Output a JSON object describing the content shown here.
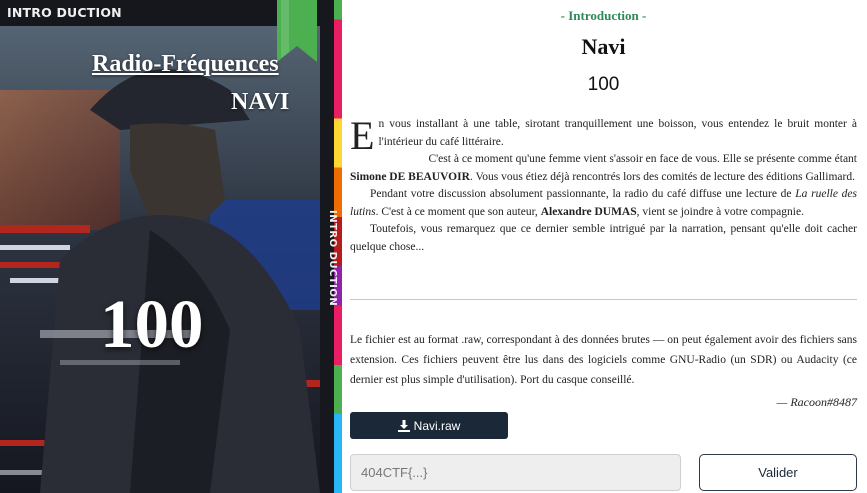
{
  "card": {
    "category_label": "INTRO DUCTION",
    "title": "Radio-Fréquences",
    "subtitle": "NAVI",
    "number": "100",
    "spine_label": "INTRO DUCTION",
    "bookmark_color": "#4caf50"
  },
  "challenge": {
    "section": "- Introduction -",
    "title": "Navi",
    "points": "100"
  },
  "story": {
    "p1_dropcap": "E",
    "p1_text": "n vous installant à une table, sirotant tranquillement une boisson, vous entendez le bruit monter à l'intérieur du café littéraire.",
    "p2_a": "C'est à ce moment qu'une femme vient s'assoir en face de vous. Elle se présente comme étant ",
    "p2_name": "Simone DE BEAUVOIR",
    "p2_b": ". Vous vous étiez déjà rencontrés lors des comités de lecture des éditions Gallimard.",
    "p3_a": "Pendant votre discussion absolument passionnante, la radio du café diffuse une lecture de ",
    "p3_book": "La ruelle des lutins",
    "p3_b": ". C'est à ce moment que son auteur, ",
    "p3_name": "Alexandre DUMAS",
    "p3_c": ", vient se joindre à votre compagnie.",
    "p4": "Toutefois, vous remarquez que ce dernier semble intrigué par la narration, pensant qu'elle doit cacher quelque chose..."
  },
  "description": "Le fichier est au format .raw, correspondant à des données brutes — on peut également avoir des fichiers sans extension. Ces fichiers peuvent être lus dans des logiciels comme GNU-Radio (un SDR) ou Audacity (ce dernier est plus simple d'utilisation). Port du casque conseillé.",
  "author": "— Racoon#8487",
  "download": {
    "label": "Navi.raw",
    "icon": "download-icon"
  },
  "flag": {
    "placeholder": "404CTF{...}",
    "value": ""
  },
  "submit_label": "Valider",
  "colors": {
    "accent_green": "#2e8b57",
    "dark_button": "#1b2838"
  }
}
